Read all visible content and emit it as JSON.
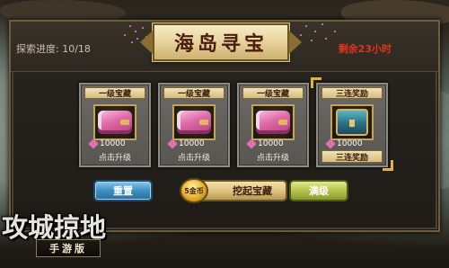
{
  "title": "海岛寻宝",
  "progress": {
    "label": "探索进度:",
    "value": "10/18"
  },
  "time_left": "剩余23小时",
  "cards": [
    {
      "title": "一级宝藏",
      "item": "scroll",
      "quantity": "10000",
      "action": "点击升级"
    },
    {
      "title": "一级宝藏",
      "item": "scroll",
      "quantity": "10000",
      "action": "点击升级"
    },
    {
      "title": "一级宝藏",
      "item": "scroll",
      "quantity": "10000",
      "action": "点击升级"
    },
    {
      "title": "三连奖励",
      "item": "treasure-chest",
      "quantity": "10000",
      "action": "三连奖励"
    }
  ],
  "buttons": {
    "reset": "重置",
    "dig": "挖起宝藏",
    "dig_cost": "5金币",
    "upgrade": "满级"
  },
  "logo": {
    "main": "攻城掠地",
    "sub": "手游版"
  },
  "colors": {
    "time_left": "#e0341e",
    "reset_button": "#3f8fc4",
    "dig_button": "#dec27d",
    "upgrade_button": "#b6c34b",
    "highlight_corner": "#e5b23c"
  }
}
